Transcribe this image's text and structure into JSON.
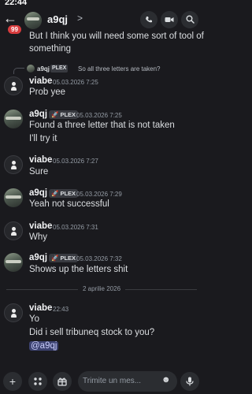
{
  "statusbar": {
    "time": "22:44",
    "right": ""
  },
  "header": {
    "name": "a9qj",
    "chevron": ">",
    "badge": "99",
    "back": "←",
    "call_icon": "phone-icon",
    "video_icon": "video-icon",
    "search_icon": "search-icon"
  },
  "top_text": {
    "line1": "But I think you will need some sort of tool of",
    "line2": "something"
  },
  "reply": {
    "name": "a9qj",
    "tag": "PLEX",
    "text": "So all three letters are taken?"
  },
  "messages": [
    {
      "author": "viabe",
      "time": "05.03.2026 7:25",
      "text": "Prob yee"
    },
    {
      "author": "a9qj",
      "tag": "PLEX",
      "time": "05.03.2026 7:25",
      "text": "Found a three letter that is not taken",
      "text2": "I'll try it"
    },
    {
      "author": "viabe",
      "time": "05.03.2026 7:27",
      "text": "Sure"
    },
    {
      "author": "a9qj",
      "tag": "PLEX",
      "time": "05.03.2026 7:29",
      "text": "Yeah not successful"
    },
    {
      "author": "viabe",
      "time": "05.03.2026 7:31",
      "text": "Why"
    },
    {
      "author": "a9qj",
      "tag": "PLEX",
      "time": "05.03.2026 7:32",
      "text": "Shows up the letters shit"
    },
    {
      "author": "viabe",
      "time": "22:43",
      "text": "Yo",
      "text2": "Did i sell tribuneq stock to you?",
      "mention": "@a9qj"
    }
  ],
  "divider": "2 aprilie 2026",
  "composer": {
    "placeholder": "Trimite un mes...",
    "plus": "+",
    "apps": "⁘",
    "gift": "🎁",
    "emoji": "☻",
    "mic": "🎙"
  },
  "colors": {
    "background": "#1a1a1e",
    "mention": "#3c4270",
    "badge": "#d83c3e"
  }
}
